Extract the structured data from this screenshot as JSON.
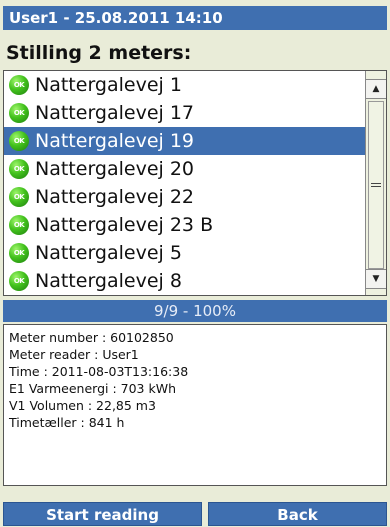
{
  "header": {
    "title": "User1 - 25.08.2011 14:10"
  },
  "heading": "Stilling 2 meters:",
  "meters": [
    {
      "label": "Nattergalevej 1",
      "status": "OK",
      "selected": false
    },
    {
      "label": "Nattergalevej 17",
      "status": "OK",
      "selected": false
    },
    {
      "label": "Nattergalevej 19",
      "status": "OK",
      "selected": true
    },
    {
      "label": "Nattergalevej 20",
      "status": "OK",
      "selected": false
    },
    {
      "label": "Nattergalevej 22",
      "status": "OK",
      "selected": false
    },
    {
      "label": "Nattergalevej 23 B",
      "status": "OK",
      "selected": false
    },
    {
      "label": "Nattergalevej 5",
      "status": "OK",
      "selected": false
    },
    {
      "label": "Nattergalevej 8",
      "status": "OK",
      "selected": false
    }
  ],
  "progress": {
    "text": "9/9 - 100%",
    "fraction": 1.0
  },
  "details": [
    "Meter number : 60102850",
    "Meter reader : User1",
    "Time : 2011-08-03T13:16:38",
    "E1 Varmeenergi : 703 kWh",
    "V1 Volumen : 22,85 m3",
    "Timetæller : 841 h"
  ],
  "buttons": {
    "start": "Start reading",
    "back": "Back"
  },
  "colors": {
    "accent": "#3f6fb0",
    "background": "#e9ecd8",
    "ok_green": "#43c21d"
  },
  "icons": {
    "status": "ok-status-icon",
    "scroll_up": "arrow-up-icon",
    "scroll_down": "arrow-down-icon"
  }
}
